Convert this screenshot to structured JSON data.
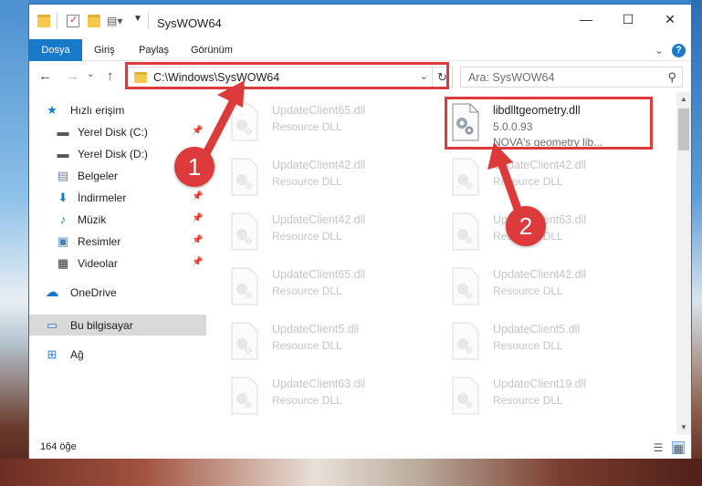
{
  "window": {
    "title": "SysWOW64",
    "controls": {
      "minimize": "—",
      "maximize": "☐",
      "close": "✕"
    }
  },
  "ribbon": {
    "tabs": [
      "Dosya",
      "Giriş",
      "Paylaş",
      "Görünüm"
    ],
    "chevron": "⌄",
    "help": "?"
  },
  "navigation": {
    "back": "←",
    "forward": "→",
    "recent": "⌄",
    "up": "↑",
    "address": "C:\\Windows\\SysWOW64",
    "address_dropdown": "⌄",
    "refresh": "↻",
    "search_placeholder": "Ara: SysWOW64",
    "search_icon": "⚲"
  },
  "sidebar": {
    "items": [
      {
        "label": "Hızlı erişim",
        "icon": "star-icon",
        "glyph": "★",
        "pinned": false
      },
      {
        "label": "Yerel Disk (C:)",
        "icon": "drive-icon",
        "glyph": "▬",
        "pinned": true
      },
      {
        "label": "Yerel Disk (D:)",
        "icon": "drive-icon",
        "glyph": "▬",
        "pinned": false
      },
      {
        "label": "Belgeler",
        "icon": "documents-icon",
        "glyph": "▤",
        "pinned": true
      },
      {
        "label": "İndirmeler",
        "icon": "download-icon",
        "glyph": "⬇",
        "pinned": true
      },
      {
        "label": "Müzik",
        "icon": "music-icon",
        "glyph": "♪",
        "pinned": true
      },
      {
        "label": "Resimler",
        "icon": "pictures-icon",
        "glyph": "▣",
        "pinned": true
      },
      {
        "label": "Videolar",
        "icon": "video-icon",
        "glyph": "▦",
        "pinned": true
      },
      {
        "label": "OneDrive",
        "icon": "cloud-icon",
        "glyph": "☁",
        "pinned": false
      },
      {
        "label": "Bu bilgisayar",
        "icon": "computer-icon",
        "glyph": "▭",
        "pinned": false
      },
      {
        "label": "Ağ",
        "icon": "network-icon",
        "glyph": "⊞",
        "pinned": false
      }
    ],
    "pin_glyph": "📌"
  },
  "files": [
    {
      "name": "UpdateClient65.dll",
      "type": "Resource DLL"
    },
    {
      "name": "libdlltgeometry.dll",
      "type": "5.0.0.93",
      "desc": "NOVA's geometry lib..."
    },
    {
      "name": "UpdateClient42.dll",
      "type": "Resource DLL"
    },
    {
      "name": "UpdateClient42.dll",
      "type": "Resource DLL"
    },
    {
      "name": "UpdateClient42.dll",
      "type": "Resource DLL"
    },
    {
      "name": "UpdateClient63.dll",
      "type": "Resource DLL"
    },
    {
      "name": "UpdateClient65.dll",
      "type": "Resource DLL"
    },
    {
      "name": "UpdateClient42.dll",
      "type": "Resource DLL"
    },
    {
      "name": "UpdateClient5.dll",
      "type": "Resource DLL"
    },
    {
      "name": "UpdateClient5.dll",
      "type": "Resource DLL"
    },
    {
      "name": "UpdateClient63.dll",
      "type": "Resource DLL"
    },
    {
      "name": "UpdateClient19.dll",
      "type": "Resource DLL"
    }
  ],
  "status": {
    "count": "164 öğe",
    "view_details": "☰",
    "view_large": "▦"
  },
  "annotations": {
    "step1": "1",
    "step2": "2",
    "color": "#dd3b3b"
  },
  "colors": {
    "accent": "#1979ca",
    "selection": "#d9d9d9"
  }
}
